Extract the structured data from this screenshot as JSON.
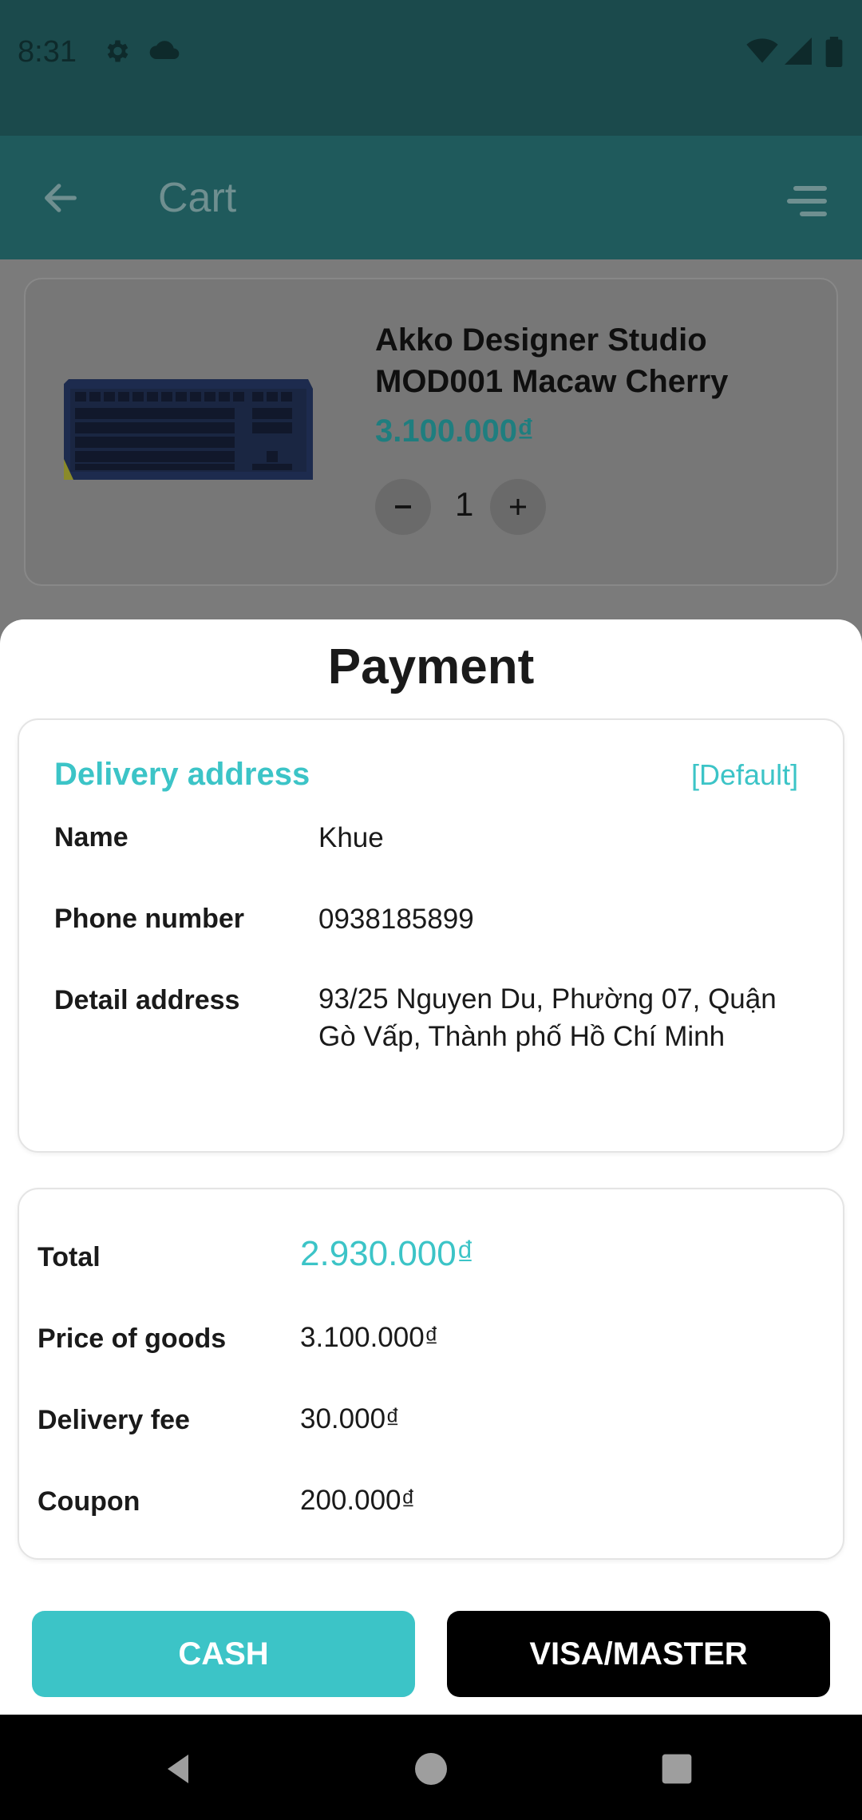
{
  "status_bar": {
    "time": "8:31"
  },
  "app_bar": {
    "title": "Cart"
  },
  "product": {
    "name": "Akko Designer Studio MOD001 Macaw Cherry",
    "price": "3.100.000₫",
    "quantity": "1"
  },
  "payment": {
    "title": "Payment",
    "address": {
      "section_title": "Delivery address",
      "default_tag": "[Default]",
      "name_label": "Name",
      "name_value": "Khue",
      "phone_label": "Phone number",
      "phone_value": "0938185899",
      "detail_label": "Detail address",
      "detail_value": "93/25 Nguyen Du, Phường 07, Quận Gò Vấp, Thành phố Hồ Chí Minh"
    },
    "summary": {
      "total_label": "Total",
      "total_value": "2.930.000₫",
      "goods_label": "Price of goods",
      "goods_value": "3.100.000₫",
      "fee_label": "Delivery fee",
      "fee_value": "30.000₫",
      "coupon_label": "Coupon",
      "coupon_value": "200.000₫"
    },
    "buttons": {
      "cash": "CASH",
      "visa": "VISA/MASTER"
    }
  },
  "colors": {
    "accent": "#3cc4c7",
    "app_bar": "#1f5a5c",
    "status_bar": "#1b4a4c"
  },
  "icons": [
    "settings-icon",
    "cloud-icon",
    "wifi-icon",
    "signal-icon",
    "battery-icon",
    "back-arrow-icon",
    "menu-icon",
    "minus-icon",
    "plus-icon",
    "nav-back-icon",
    "nav-home-icon",
    "nav-recents-icon"
  ]
}
